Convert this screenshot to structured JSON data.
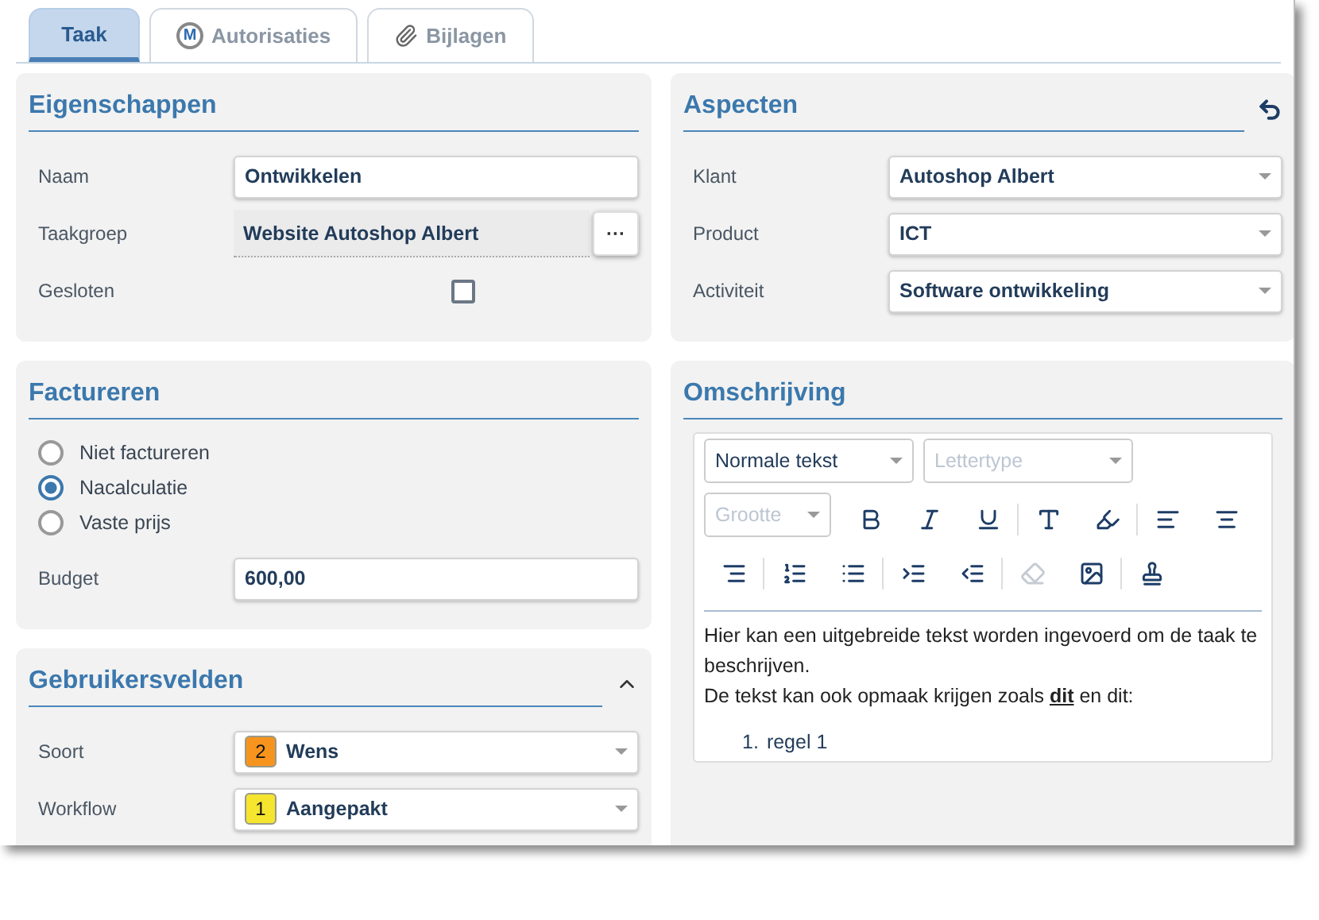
{
  "tabs": [
    {
      "label": "Taak",
      "selected": true,
      "kind": "plain"
    },
    {
      "label": "Autorisaties",
      "selected": false,
      "kind": "badge",
      "badge": "M"
    },
    {
      "label": "Bijlagen",
      "selected": false,
      "kind": "attachment"
    }
  ],
  "properties": {
    "title": "Eigenschappen",
    "fields": [
      {
        "label": "Naam",
        "kind": "text",
        "value": "Ontwikkelen"
      },
      {
        "label": "Taakgroep",
        "kind": "lookup",
        "value": "Website Autoshop Albert",
        "button": "···"
      },
      {
        "label": "Gesloten",
        "kind": "checkbox",
        "checked": false
      }
    ]
  },
  "billing": {
    "title": "Factureren",
    "options": [
      {
        "label": "Niet factureren",
        "selected": false
      },
      {
        "label": "Nacalculatie",
        "selected": true
      },
      {
        "label": "Vaste prijs",
        "selected": false
      }
    ],
    "budget": {
      "label": "Budget",
      "value": "600,00"
    }
  },
  "user_fields": {
    "title": "Gebruikersvelden",
    "expanded": true,
    "fields": [
      {
        "label": "Soort",
        "badge": "2",
        "color": "#f7941d",
        "value": "Wens"
      },
      {
        "label": "Workflow",
        "badge": "1",
        "color": "#f5e52f",
        "value": "Aangepakt"
      }
    ]
  },
  "aspects": {
    "title": "Aspecten",
    "fields": [
      {
        "label": "Klant",
        "value": "Autoshop Albert"
      },
      {
        "label": "Product",
        "value": "ICT"
      },
      {
        "label": "Activiteit",
        "value": "Software ontwikkeling"
      }
    ]
  },
  "description": {
    "title": "Omschrijving",
    "style_select": {
      "value": "Normale tekst"
    },
    "font_select": {
      "placeholder": "Lettertype"
    },
    "size_select": {
      "placeholder": "Grootte"
    },
    "tools": [
      {
        "kind": "bold",
        "disabled": false
      },
      {
        "kind": "italic",
        "disabled": false
      },
      {
        "kind": "underline",
        "disabled": false
      },
      {
        "kind": "sep"
      },
      {
        "kind": "font-color",
        "disabled": false
      },
      {
        "kind": "highlight",
        "disabled": false
      },
      {
        "kind": "sep"
      },
      {
        "kind": "align-left",
        "disabled": false
      },
      {
        "kind": "align-center",
        "disabled": false
      },
      {
        "kind": "align-right",
        "disabled": false
      },
      {
        "kind": "sep"
      },
      {
        "kind": "ordered-list",
        "disabled": false
      },
      {
        "kind": "bullet-list",
        "disabled": false
      },
      {
        "kind": "sep"
      },
      {
        "kind": "indent",
        "disabled": false
      },
      {
        "kind": "outdent",
        "disabled": false
      },
      {
        "kind": "sep"
      },
      {
        "kind": "eraser",
        "disabled": true
      },
      {
        "kind": "image",
        "disabled": false
      },
      {
        "kind": "sep"
      },
      {
        "kind": "stamp",
        "disabled": false
      }
    ],
    "paragraphs": [
      "Hier kan een uitgebreide tekst worden ingevoerd om de taak te beschrijven.",
      "De tekst kan ook opmaak krijgen zoals **dit** en dit:"
    ],
    "list": [
      {
        "marker": "1.",
        "text": "regel 1"
      }
    ]
  }
}
